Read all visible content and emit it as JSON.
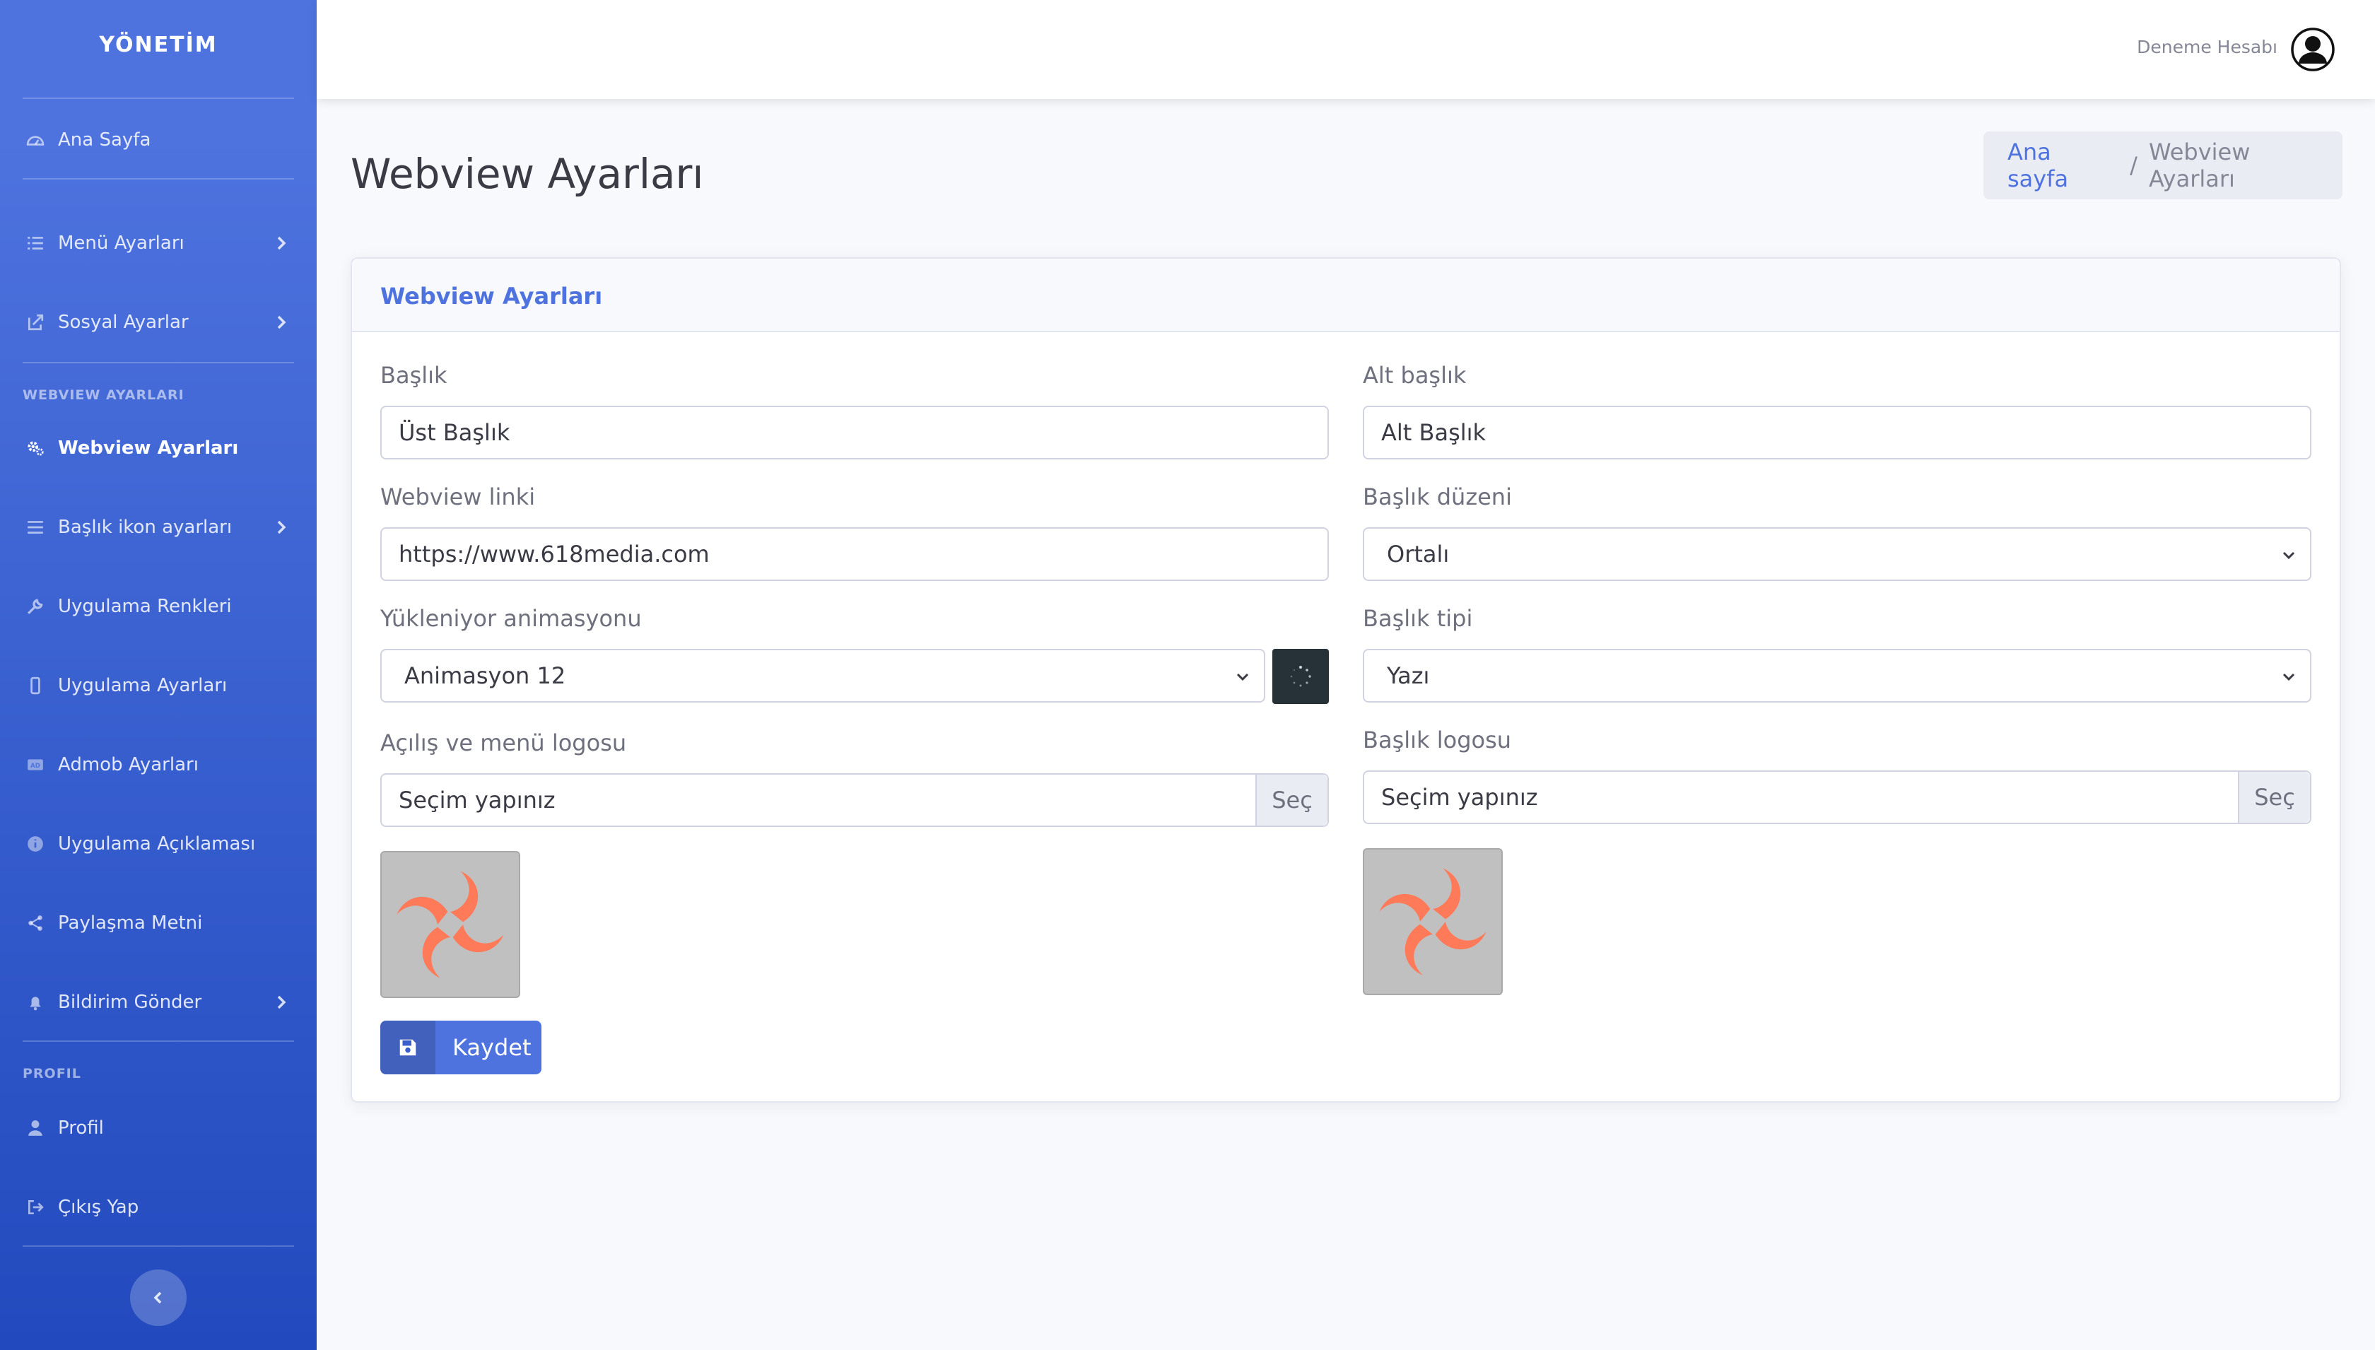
{
  "sidebar": {
    "brand": "YÖNETİM",
    "items": [
      {
        "label": "Ana Sayfa"
      },
      {
        "label": "Menü Ayarları"
      },
      {
        "label": "Sosyal Ayarlar"
      },
      {
        "label": "Webview Ayarları"
      },
      {
        "label": "Başlık ikon ayarları"
      },
      {
        "label": "Uygulama Renkleri"
      },
      {
        "label": "Uygulama Ayarları"
      },
      {
        "label": "Admob Ayarları"
      },
      {
        "label": "Uygulama Açıklaması"
      },
      {
        "label": "Paylaşma Metni"
      },
      {
        "label": "Bildirim Gönder"
      },
      {
        "label": "Profil"
      },
      {
        "label": "Çıkış Yap"
      }
    ],
    "headings": {
      "webview": "WEBVIEW AYARLARI",
      "profil": "PROFIL"
    }
  },
  "topbar": {
    "user_name": "Deneme Hesabı"
  },
  "page": {
    "title": "Webview Ayarları",
    "breadcrumb": {
      "home": "Ana sayfa",
      "separator": "/",
      "current": "Webview Ayarları"
    }
  },
  "card": {
    "title": "Webview Ayarları",
    "fields": {
      "baslik": {
        "label": "Başlık",
        "value": "Üst Başlık"
      },
      "alt_baslik": {
        "label": "Alt başlık",
        "value": "Alt Başlık"
      },
      "webview_linki": {
        "label": "Webview linki",
        "value": "https://www.618media.com"
      },
      "baslik_duzeni": {
        "label": "Başlık düzeni",
        "value": "Ortalı"
      },
      "yukleniyor": {
        "label": "Yükleniyor animasyonu",
        "value": "Animasyon 12"
      },
      "baslik_tipi": {
        "label": "Başlık tipi",
        "value": "Yazı"
      },
      "acilis_logo": {
        "label": "Açılış ve menü logosu",
        "placeholder": "Seçim yapınız",
        "button": "Seç"
      },
      "baslik_logo": {
        "label": "Başlık logosu",
        "placeholder": "Seçim yapınız",
        "button": "Seç"
      }
    },
    "save_label": "Kaydet"
  },
  "colors": {
    "primary": "#4e73df",
    "sidebar_end": "#224abe",
    "logo_orange": "#ff7a59"
  }
}
